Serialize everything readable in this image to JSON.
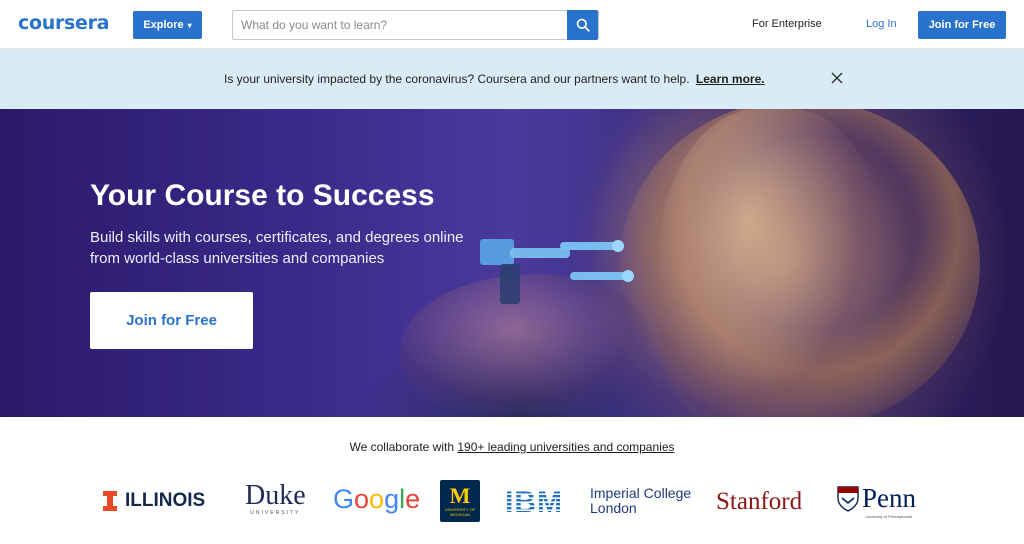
{
  "header": {
    "logo": "coursera",
    "explore_label": "Explore",
    "search_placeholder": "What do you want to learn?",
    "enterprise_label": "For Enterprise",
    "login_label": "Log In",
    "join_label": "Join for Free"
  },
  "banner": {
    "text": "Is your university impacted by the coronavirus? Coursera and our partners want to help.",
    "link": "Learn more."
  },
  "hero": {
    "title": "Your Course to Success",
    "subtitle": "Build skills with courses, certificates, and degrees online from world-class universities and companies",
    "cta": "Join for Free"
  },
  "partners": {
    "intro": "We collaborate with",
    "link": "190+ leading universities and companies",
    "logos": {
      "illinois": "ILLINOIS",
      "duke": "Duke",
      "duke_sub": "UNIVERSITY",
      "google": "Google",
      "michigan": "M",
      "michigan_sub": "UNIVERSITY OF MICHIGAN",
      "ibm": "IBM",
      "imperial_line1": "Imperial College",
      "imperial_line2": "London",
      "stanford": "Stanford",
      "penn": "Penn",
      "penn_sub": "University of Pennsylvania"
    }
  },
  "colors": {
    "brand_blue": "#2a73cc",
    "banner_bg": "#d9ecf5",
    "hero_purple": "#3b2a8a"
  }
}
